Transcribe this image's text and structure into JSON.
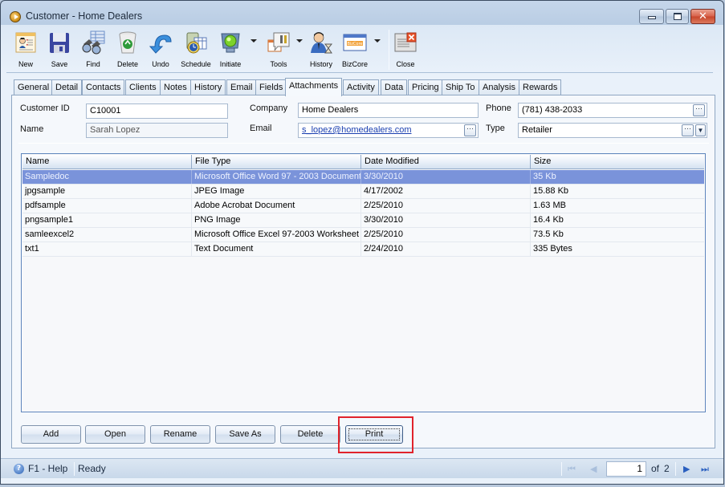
{
  "window": {
    "title": "Customer - Home Dealers",
    "controls": {
      "minimize": "minimize",
      "maximize": "maximize",
      "close": "close"
    }
  },
  "toolbar": {
    "buttons": [
      {
        "id": "new",
        "label": "New",
        "icon": "new-customer-icon"
      },
      {
        "id": "save",
        "label": "Save",
        "icon": "floppy-disk-icon"
      },
      {
        "id": "find",
        "label": "Find",
        "icon": "binoculars-icon"
      },
      {
        "id": "delete",
        "label": "Delete",
        "icon": "recycle-bin-icon"
      },
      {
        "id": "undo",
        "label": "Undo",
        "icon": "undo-arrow-icon"
      },
      {
        "id": "schedule",
        "label": "Schedule",
        "icon": "schedule-clock-icon"
      },
      {
        "id": "initiate",
        "label": "Initiate",
        "icon": "traffic-light-icon",
        "dropdown": true
      },
      {
        "id": "tools",
        "label": "Tools",
        "icon": "tools-icon",
        "dropdown": true
      },
      {
        "id": "history",
        "label": "History",
        "icon": "user-hourglass-icon"
      },
      {
        "id": "bizcore",
        "label": "BizCore",
        "icon": "bizcore-icon",
        "dropdown": true
      },
      {
        "id": "close",
        "label": "Close",
        "icon": "close-window-icon"
      }
    ]
  },
  "tabs": [
    {
      "label": "General"
    },
    {
      "label": "Detail"
    },
    {
      "label": "Contacts"
    },
    {
      "label": "Clients"
    },
    {
      "label": "Notes"
    },
    {
      "label": "History"
    },
    {
      "label": "Email"
    },
    {
      "label": "Fields"
    },
    {
      "label": "Attachments",
      "active": true
    },
    {
      "label": "Activity"
    },
    {
      "label": "Data"
    },
    {
      "label": "Pricing"
    },
    {
      "label": "Ship To"
    },
    {
      "label": "Analysis"
    },
    {
      "label": "Rewards"
    }
  ],
  "form": {
    "customer_id": {
      "label": "Customer ID",
      "value": "C10001"
    },
    "name": {
      "label": "Name",
      "value": "Sarah Lopez"
    },
    "company": {
      "label": "Company",
      "value": "Home Dealers"
    },
    "email": {
      "label": "Email",
      "value": "s_lopez@homedealers.com"
    },
    "phone": {
      "label": "Phone",
      "value": "(781) 438-2033"
    },
    "type": {
      "label": "Type",
      "value": "Retailer"
    },
    "ellipsis": "···",
    "dropdown_glyph": "▼"
  },
  "attachments": {
    "columns": [
      "Name",
      "File Type",
      "Date Modified",
      "Size"
    ],
    "rows": [
      {
        "name": "Sampledoc",
        "file_type": "Microsoft Office Word 97 - 2003 Document",
        "date_modified": "3/30/2010",
        "size": "35 Kb",
        "selected": true
      },
      {
        "name": "jpgsample",
        "file_type": "JPEG Image",
        "date_modified": "4/17/2002",
        "size": "15.88 Kb"
      },
      {
        "name": "pdfsample",
        "file_type": "Adobe Acrobat Document",
        "date_modified": "2/25/2010",
        "size": "1.63 MB"
      },
      {
        "name": "pngsample1",
        "file_type": "PNG Image",
        "date_modified": "3/30/2010",
        "size": "16.4 Kb"
      },
      {
        "name": "samleexcel2",
        "file_type": "Microsoft Office Excel 97-2003 Worksheet",
        "date_modified": "2/25/2010",
        "size": "73.5 Kb"
      },
      {
        "name": "txt1",
        "file_type": "Text Document",
        "date_modified": "2/24/2010",
        "size": "335 Bytes"
      }
    ]
  },
  "actions": {
    "add": "Add",
    "open": "Open",
    "rename": "Rename",
    "save_as": "Save As",
    "delete": "Delete",
    "print": "Print"
  },
  "statusbar": {
    "help": "F1 - Help",
    "status": "Ready",
    "page": "1",
    "of_label": "of",
    "total_pages": "2",
    "help_glyph": "?",
    "first_glyph": "⏮",
    "prev_glyph": "◀",
    "next_glyph": "▶",
    "last_glyph": "⏭"
  },
  "colors": {
    "selected_row": "#7a93da",
    "highlight_box": "#e0232b",
    "link": "#1a3fb0"
  }
}
